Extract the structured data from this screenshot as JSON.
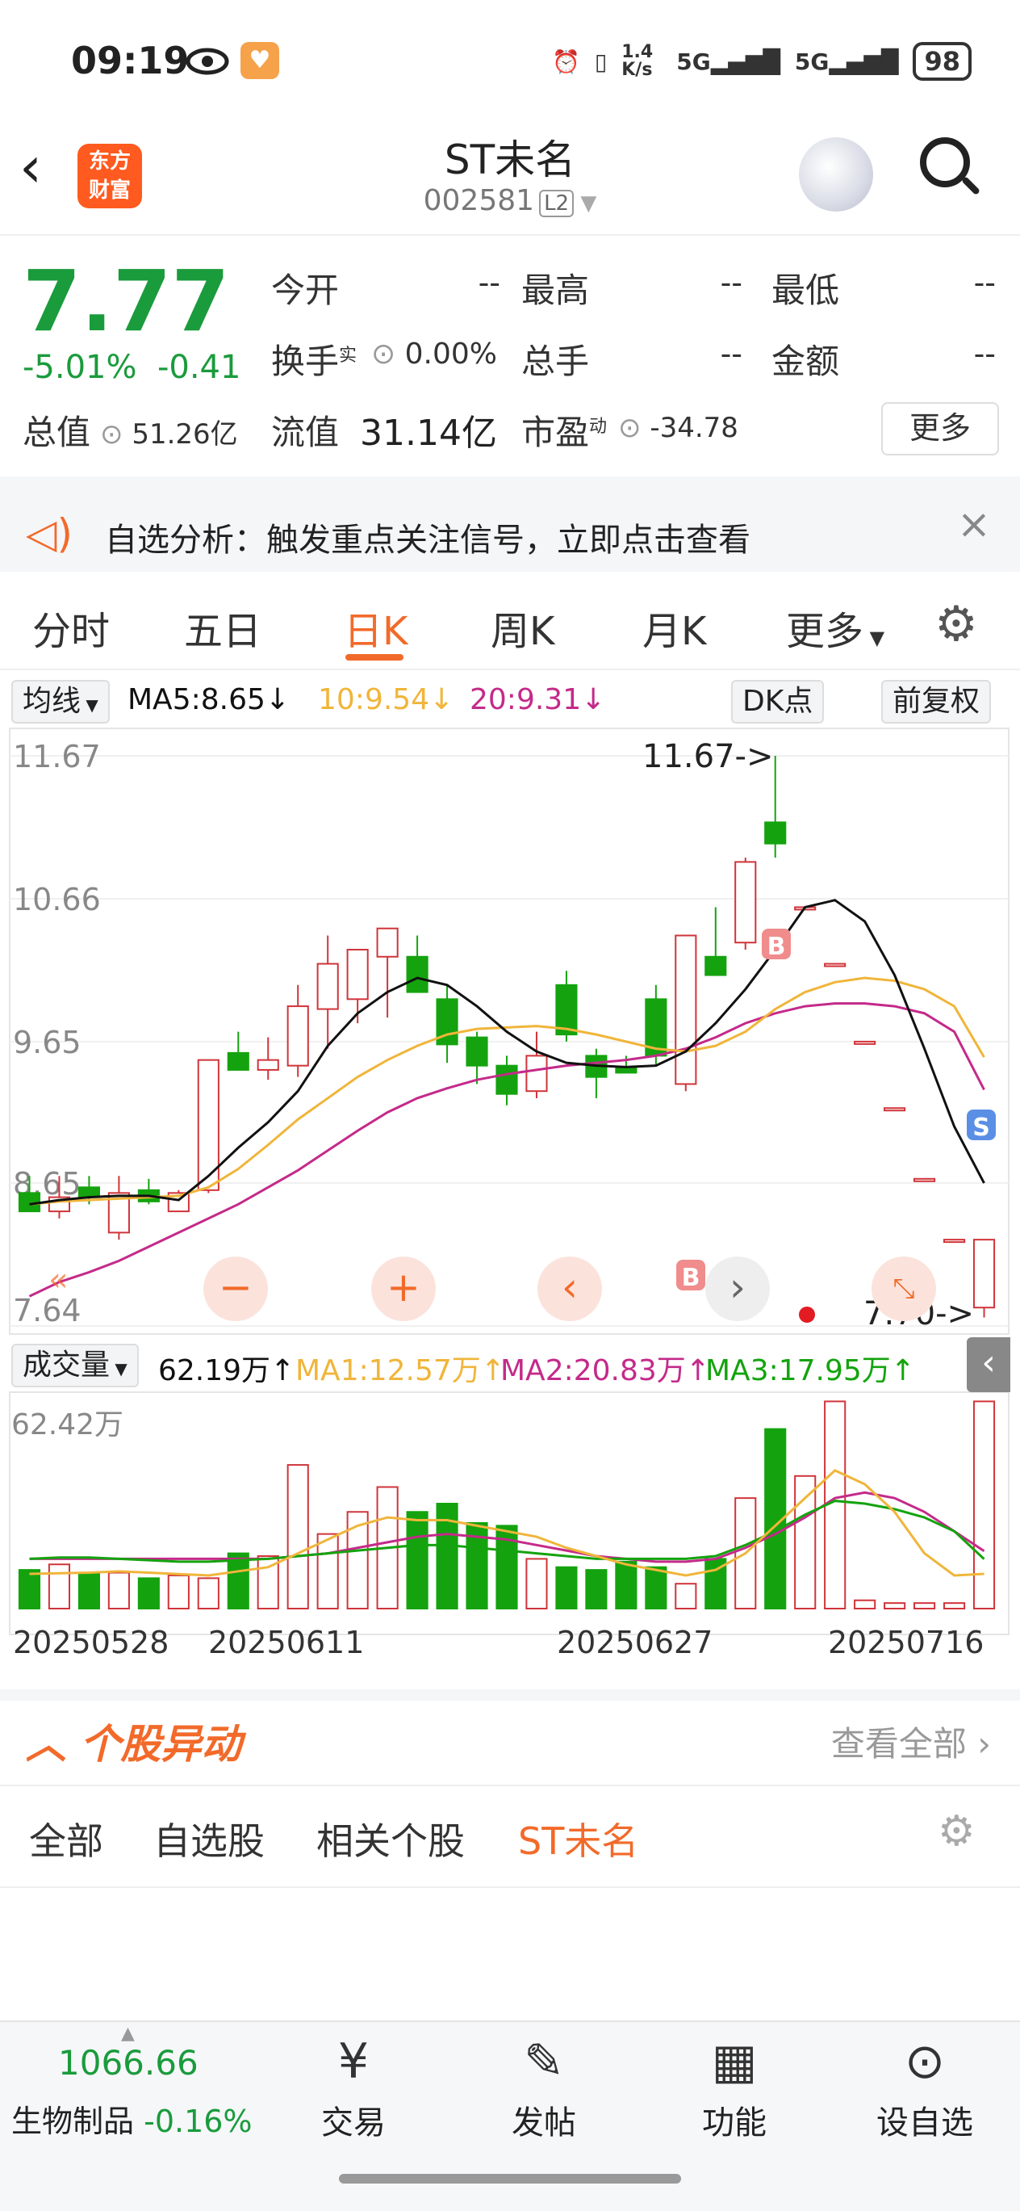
{
  "status": {
    "time": "09:19",
    "network_speed": "1.4 K/s",
    "signal1": "5G",
    "signal2": "5G",
    "battery": "98"
  },
  "header": {
    "brand": "东方财富",
    "stock_name": "ST未名",
    "stock_code": "002581",
    "level": "L2"
  },
  "quote": {
    "price": "7.77",
    "change_pct": "-5.01%",
    "change": "-0.41",
    "open_label": "今开",
    "open": "--",
    "high_label": "最高",
    "high": "--",
    "low_label": "最低",
    "low": "--",
    "turnover_label": "换手",
    "turnover_sup": "实",
    "turnover": "0.00%",
    "volume_label": "总手",
    "volume": "--",
    "amount_label": "金额",
    "amount": "--",
    "mktcap_label": "总值",
    "mktcap": "51.26亿",
    "float_label": "流值",
    "float_val": "31.14亿",
    "pe_label": "市盈",
    "pe_sup": "动",
    "pe": "-34.78",
    "more": "更多"
  },
  "notice": {
    "text": "自选分析：触发重点关注信号，立即点击查看"
  },
  "tabs": [
    "分时",
    "五日",
    "日K",
    "周K",
    "月K",
    "更多"
  ],
  "ma_bar": {
    "label": "均线",
    "ma5": "MA5:8.65",
    "ma10": "10:9.54",
    "ma20": "20:9.31",
    "dk": "DK点",
    "adjust": "前复权"
  },
  "volume_bar": {
    "label": "成交量",
    "vol": "62.19万",
    "ma1": "MA1:12.57万",
    "ma2": "MA2:20.83万",
    "ma3": "MA3:17.95万"
  },
  "colors": {
    "up": "#d0343a",
    "down": "#14a30e",
    "accent": "#f26a2a",
    "ma5": "#111111",
    "ma10": "#f0b53a",
    "ma20": "#c42a8a"
  },
  "chart_data": {
    "type": "candlestick",
    "y_ticks": [
      "11.67",
      "10.66",
      "9.65",
      "8.65",
      "7.64"
    ],
    "ylim": [
      7.64,
      11.67
    ],
    "high_annotation": "11.67->",
    "low_annotation": "7.70->",
    "signals": [
      "B",
      "B",
      "S"
    ],
    "candles": [
      {
        "o": 8.58,
        "h": 8.7,
        "l": 8.45,
        "c": 8.45
      },
      {
        "o": 8.45,
        "h": 8.7,
        "l": 8.4,
        "c": 8.55
      },
      {
        "o": 8.62,
        "h": 8.7,
        "l": 8.5,
        "c": 8.55
      },
      {
        "o": 8.3,
        "h": 8.7,
        "l": 8.25,
        "c": 8.58
      },
      {
        "o": 8.6,
        "h": 8.68,
        "l": 8.5,
        "c": 8.52
      },
      {
        "o": 8.45,
        "h": 8.6,
        "l": 8.45,
        "c": 8.58
      },
      {
        "o": 8.6,
        "h": 9.52,
        "l": 8.58,
        "c": 9.52
      },
      {
        "o": 9.57,
        "h": 9.72,
        "l": 9.45,
        "c": 9.45
      },
      {
        "o": 9.45,
        "h": 9.68,
        "l": 9.38,
        "c": 9.52
      },
      {
        "o": 9.48,
        "h": 10.05,
        "l": 9.4,
        "c": 9.9
      },
      {
        "o": 9.88,
        "h": 10.4,
        "l": 9.6,
        "c": 10.2
      },
      {
        "o": 9.95,
        "h": 10.28,
        "l": 9.78,
        "c": 10.3
      },
      {
        "o": 10.25,
        "h": 10.4,
        "l": 9.82,
        "c": 10.45
      },
      {
        "o": 10.25,
        "h": 10.4,
        "l": 10.05,
        "c": 10.0
      },
      {
        "o": 9.95,
        "h": 10.05,
        "l": 9.5,
        "c": 9.63
      },
      {
        "o": 9.68,
        "h": 9.72,
        "l": 9.35,
        "c": 9.48
      },
      {
        "o": 9.48,
        "h": 9.55,
        "l": 9.2,
        "c": 9.28
      },
      {
        "o": 9.3,
        "h": 9.72,
        "l": 9.25,
        "c": 9.55
      },
      {
        "o": 10.05,
        "h": 10.15,
        "l": 9.65,
        "c": 9.7
      },
      {
        "o": 9.55,
        "h": 9.6,
        "l": 9.25,
        "c": 9.4
      },
      {
        "o": 9.47,
        "h": 9.55,
        "l": 9.43,
        "c": 9.43
      },
      {
        "o": 9.95,
        "h": 10.05,
        "l": 9.48,
        "c": 9.55
      },
      {
        "o": 9.35,
        "h": 10.4,
        "l": 9.3,
        "c": 10.4
      },
      {
        "o": 10.25,
        "h": 10.6,
        "l": 10.12,
        "c": 10.12
      },
      {
        "o": 10.35,
        "h": 10.95,
        "l": 10.3,
        "c": 10.92
      },
      {
        "o": 11.2,
        "h": 11.67,
        "l": 10.95,
        "c": 11.05
      },
      {
        "o": 10.6,
        "h": 10.6,
        "l": 10.6,
        "c": 10.6
      },
      {
        "o": 10.2,
        "h": 10.2,
        "l": 10.2,
        "c": 10.2
      },
      {
        "o": 9.65,
        "h": 9.65,
        "l": 9.65,
        "c": 9.65
      },
      {
        "o": 9.18,
        "h": 9.18,
        "l": 9.18,
        "c": 9.18
      },
      {
        "o": 8.68,
        "h": 8.68,
        "l": 8.68,
        "c": 8.68
      },
      {
        "o": 8.25,
        "h": 8.25,
        "l": 8.25,
        "c": 8.25
      },
      {
        "o": 7.77,
        "h": 8.18,
        "l": 7.7,
        "c": 8.25
      }
    ],
    "ma5": [
      8.5,
      8.53,
      8.55,
      8.56,
      8.56,
      8.53,
      8.7,
      8.9,
      9.08,
      9.3,
      9.62,
      9.85,
      10.0,
      10.1,
      10.05,
      9.9,
      9.72,
      9.58,
      9.5,
      9.48,
      9.47,
      9.48,
      9.58,
      9.78,
      10.02,
      10.3,
      10.6,
      10.65,
      10.5,
      10.12,
      9.6,
      9.05,
      8.65
    ],
    "ma10": [
      8.5,
      8.52,
      8.53,
      8.54,
      8.55,
      8.56,
      8.62,
      8.75,
      8.92,
      9.1,
      9.25,
      9.4,
      9.52,
      9.62,
      9.7,
      9.74,
      9.75,
      9.76,
      9.74,
      9.7,
      9.65,
      9.6,
      9.58,
      9.62,
      9.72,
      9.88,
      10.0,
      10.07,
      10.1,
      10.08,
      10.02,
      9.9,
      9.54
    ],
    "ma20": [
      7.85,
      7.95,
      8.02,
      8.1,
      8.2,
      8.3,
      8.4,
      8.5,
      8.62,
      8.74,
      8.88,
      9.02,
      9.15,
      9.25,
      9.32,
      9.38,
      9.42,
      9.45,
      9.48,
      9.5,
      9.52,
      9.55,
      9.6,
      9.68,
      9.78,
      9.85,
      9.9,
      9.92,
      9.92,
      9.9,
      9.85,
      9.72,
      9.31
    ],
    "volume": {
      "y_max_label": "62.42万",
      "values": [
        14,
        16,
        13,
        13,
        11,
        12,
        11,
        20,
        19,
        52,
        27,
        35,
        44,
        35,
        38,
        31,
        30,
        18,
        15,
        14,
        17,
        15,
        9,
        18,
        40,
        65,
        48,
        75,
        3,
        2,
        2,
        2,
        75
      ],
      "ma1": [
        12.57,
        12.8,
        13,
        13.5,
        13,
        12.5,
        12,
        13.5,
        15,
        20,
        25,
        30,
        33,
        32,
        32,
        30,
        28,
        26,
        22,
        19,
        16,
        14,
        12,
        14,
        20,
        30,
        40,
        50,
        45,
        35,
        20,
        12,
        12.57
      ],
      "ma2": [
        18,
        18,
        18,
        18,
        18,
        18,
        18,
        18,
        18,
        19,
        20,
        22,
        24,
        26,
        27,
        26,
        25,
        23,
        21,
        19,
        18,
        17,
        17,
        18,
        22,
        27,
        33,
        40,
        42,
        40,
        35,
        28,
        20.83
      ],
      "ma3": [
        18,
        18.5,
        18.5,
        18,
        17.5,
        17,
        17,
        17.5,
        18,
        19,
        20,
        21,
        22,
        23,
        23,
        22,
        21,
        20,
        19,
        18,
        18,
        18,
        18,
        19,
        23,
        28,
        34,
        39,
        38,
        36,
        33,
        28,
        17.95
      ]
    },
    "dates": [
      "20250528",
      "20250611",
      "20250627",
      "20250716"
    ]
  },
  "movers": {
    "title": "个股异动",
    "see_all": "查看全部",
    "tabs": [
      "全部",
      "自选股",
      "相关个股",
      "ST未名"
    ]
  },
  "bottom": {
    "index_value": "1066.66",
    "index_name": "生物制品",
    "index_change": "-0.16%",
    "nav": [
      "交易",
      "发帖",
      "功能",
      "设自选"
    ]
  }
}
